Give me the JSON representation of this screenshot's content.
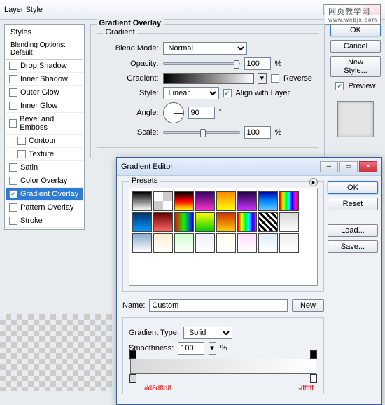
{
  "watermark": "网页教学网",
  "watermark_url": "www.webjx.com",
  "layerStyle": {
    "title": "Layer Style",
    "stylesHeader": "Styles",
    "blendingDefault": "Blending Options: Default",
    "items": [
      {
        "label": "Drop Shadow",
        "checked": false
      },
      {
        "label": "Inner Shadow",
        "checked": false
      },
      {
        "label": "Outer Glow",
        "checked": false
      },
      {
        "label": "Inner Glow",
        "checked": false
      },
      {
        "label": "Bevel and Emboss",
        "checked": false
      },
      {
        "label": "Contour",
        "checked": false,
        "indent": true
      },
      {
        "label": "Texture",
        "checked": false,
        "indent": true
      },
      {
        "label": "Satin",
        "checked": false
      },
      {
        "label": "Color Overlay",
        "checked": false
      },
      {
        "label": "Gradient Overlay",
        "checked": true,
        "selected": true
      },
      {
        "label": "Pattern Overlay",
        "checked": false
      },
      {
        "label": "Stroke",
        "checked": false
      }
    ],
    "panel": {
      "title": "Gradient Overlay",
      "subTitle": "Gradient",
      "blendModeLabel": "Blend Mode:",
      "blendMode": "Normal",
      "opacityLabel": "Opacity:",
      "opacity": "100",
      "pct": "%",
      "gradientLabel": "Gradient:",
      "reverseLabel": "Reverse",
      "styleLabel": "Style:",
      "style": "Linear",
      "alignLabel": "Align with Layer",
      "alignChecked": true,
      "angleLabel": "Angle:",
      "angle": "90",
      "deg": "°",
      "scaleLabel": "Scale:",
      "scale": "100"
    },
    "buttons": {
      "ok": "OK",
      "cancel": "Cancel",
      "newStyle": "New Style...",
      "previewLabel": "Preview"
    }
  },
  "gradientEditor": {
    "title": "Gradient Editor",
    "presetsLabel": "Presets",
    "nameLabel": "Name:",
    "name": "Custom",
    "newBtn": "New",
    "gradTypeLabel": "Gradient Type:",
    "gradType": "Solid",
    "smoothLabel": "Smoothness:",
    "smoothness": "100",
    "pct": "%",
    "leftHex": "#d8d8d8",
    "rightHex": "#ffffff",
    "buttons": {
      "ok": "OK",
      "reset": "Reset",
      "load": "Load...",
      "save": "Save..."
    },
    "swatches": [
      "linear-gradient(#000,#fff)",
      "repeating-conic-gradient(#ccc 0 25%,#fff 0 50%)",
      "linear-gradient(#000,#f00,#ff0)",
      "linear-gradient(#306,#f3c)",
      "linear-gradient(#f80,#ff0)",
      "linear-gradient(#204,#c3f)",
      "linear-gradient(#00a,#08f,#6cf)",
      "linear-gradient(90deg,#f00,#ff0,#0f0,#0ff,#00f,#f0f,#f00)",
      "linear-gradient(#036,#09f)",
      "linear-gradient(#600,#f66)",
      "linear-gradient(90deg,#f00,#0f0,#00f)",
      "linear-gradient(#ff0,#0c0)",
      "linear-gradient(#c30,#fc0)",
      "linear-gradient(90deg,#f00,#ff0,#0f0,#0ff,#00f,#f0f)",
      "repeating-linear-gradient(45deg,#000 0 3px,#fff 3px 6px)",
      "linear-gradient(#d8d8d8,#fff)",
      "linear-gradient(#8ac,#fff)",
      "linear-gradient(#fec,#fff)",
      "linear-gradient(#cfc,#fff)",
      "linear-gradient(#eef,#fff)",
      "linear-gradient(#ffe,#fff)",
      "linear-gradient(#fdf,#fff)",
      "linear-gradient(#def,#fff)",
      "linear-gradient(#eee,#fff)"
    ]
  }
}
